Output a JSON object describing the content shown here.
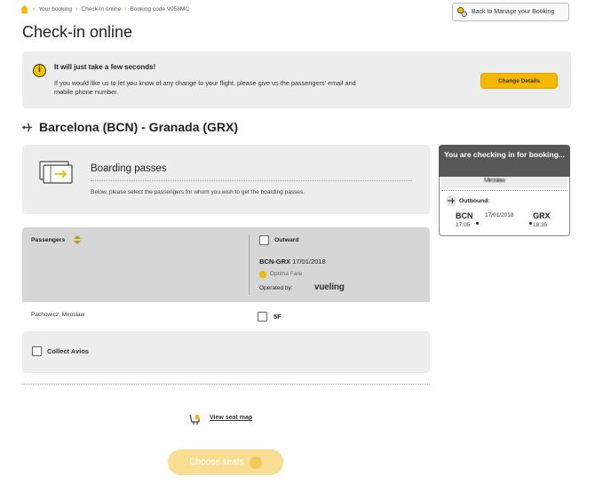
{
  "breadcrumb": {
    "items": [
      "Your booking",
      "Check-in online",
      "Booking code V958MC"
    ]
  },
  "header": {
    "back_label": "Back to Manage your Booking",
    "title": "Check-in online"
  },
  "info": {
    "title": "It will just take a few seconds!",
    "text": "If you would like us to let you know of any change to your flight, please give us the passengers' email and mobile phone number.",
    "button": "Change Details"
  },
  "route": {
    "title": "Barcelona (BCN) - Granada (GRX)"
  },
  "boarding": {
    "title": "Boarding passes",
    "text": "Below, please select the passengers for whom you wish to get the boarding passes."
  },
  "table": {
    "passengers_header": "Passengers",
    "outward_label": "Outward",
    "flight_route": "BCN-GRX",
    "flight_date": "17/01/2018",
    "fare": "Optima Fare",
    "operated_by": "Operated by:",
    "carrier": "vueling",
    "passenger_name": "Pachowicz, Miroslaw",
    "seat": "5F"
  },
  "avios": {
    "label": "Collect Avios"
  },
  "actions": {
    "seat_map": "View seat map",
    "choose_seats": "Choose seats"
  },
  "sidebar": {
    "title": "You are checking in for booking...",
    "passenger": "Miroslaw",
    "outbound_label": "Outbound:",
    "dep_code": "BCN",
    "dep_time": "17:05",
    "date": "17/01/2018",
    "arr_code": "GRX",
    "arr_time": "18:35"
  },
  "colors": {
    "accent": "#f5b800",
    "panel": "#ededed",
    "table_header": "#d6d6d6",
    "sidebar_header": "#575757"
  }
}
